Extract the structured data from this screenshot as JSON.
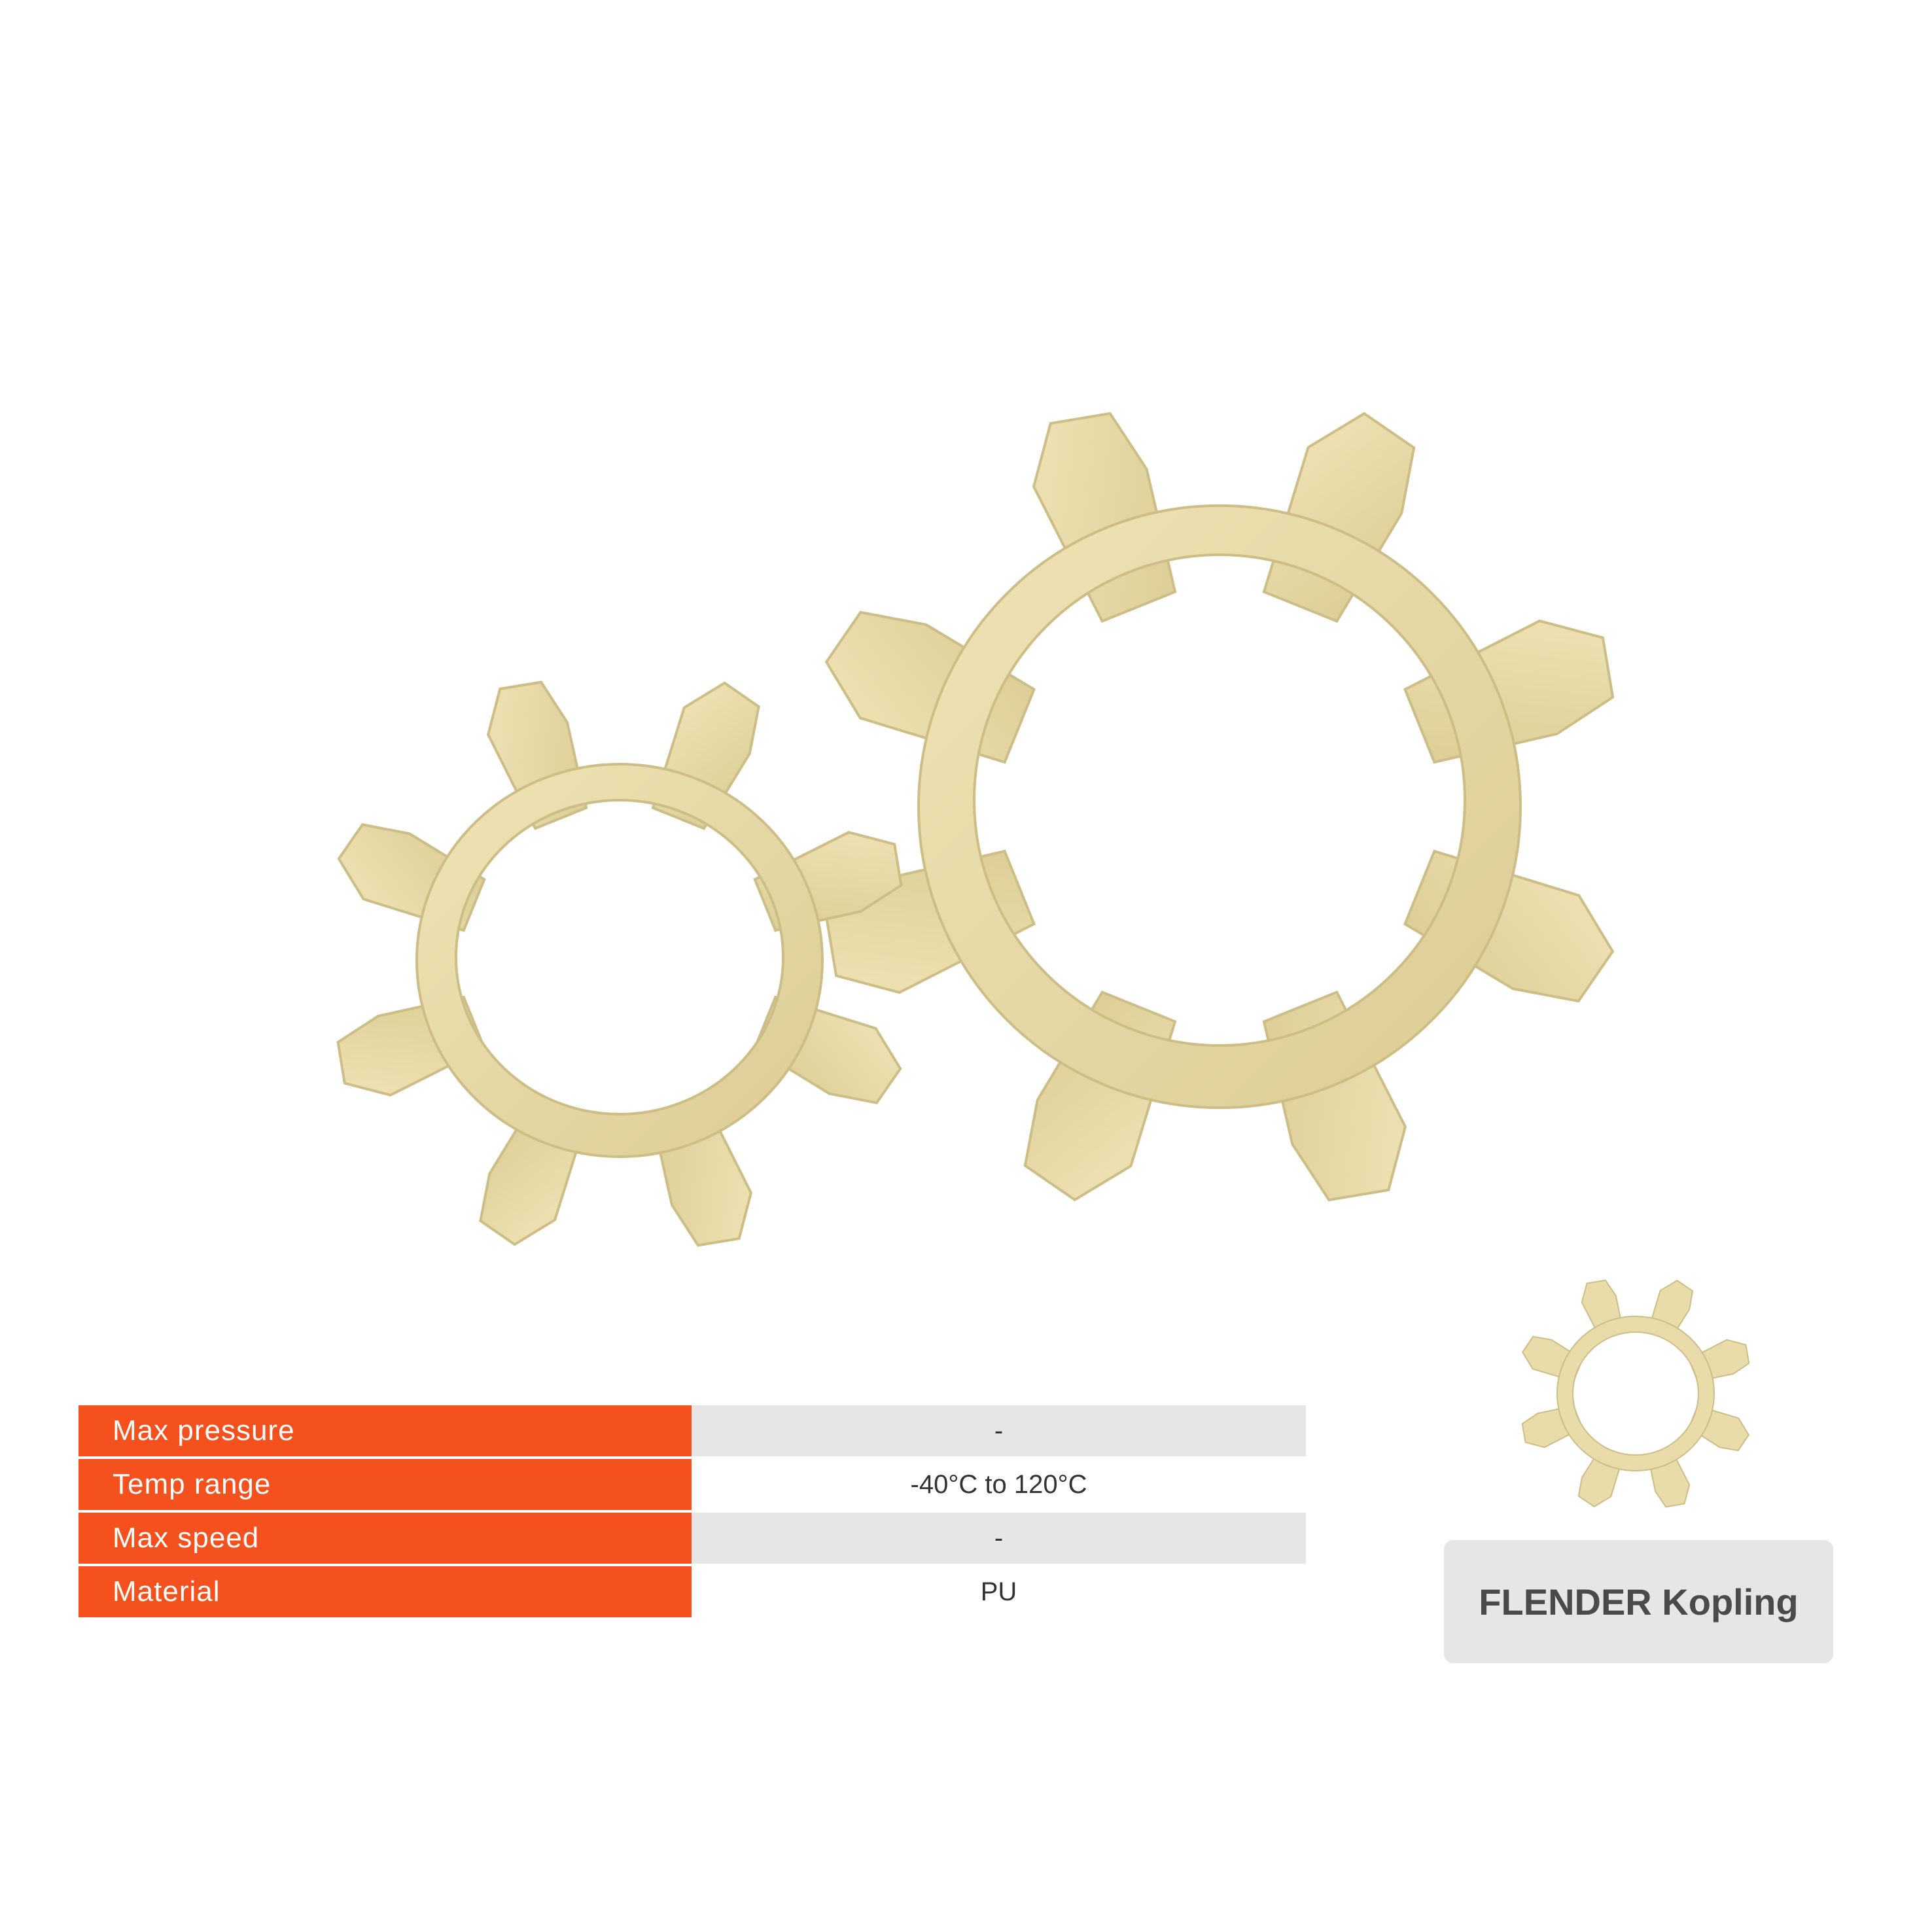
{
  "specs": [
    {
      "label": "Max pressure",
      "value": "-"
    },
    {
      "label": "Temp range",
      "value": "-40°C to 120°C"
    },
    {
      "label": "Max speed",
      "value": "-"
    },
    {
      "label": "Material",
      "value": "PU"
    }
  ],
  "product_name": "FLENDER Kopling",
  "colors": {
    "accent": "#f4511e",
    "row_shade": "#e6e6e6",
    "product": "#e8dcaa",
    "product_shadow": "#cfc08a",
    "card_text": "#4a4a4a"
  },
  "icons": {
    "product_photo": "spider-coupling-pair",
    "thumbnail": "spider-coupling-icon"
  }
}
